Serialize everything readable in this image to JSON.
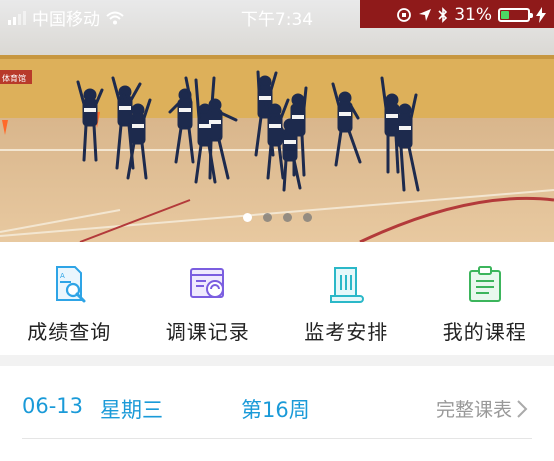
{
  "status_bar": {
    "carrier": "中国移动",
    "time": "下午7:34",
    "battery_percent": "31%",
    "battery_level": 0.31,
    "battery_color": "#4cd964"
  },
  "banner": {
    "sign_text": "体育馆",
    "slide_count": 4,
    "active_slide": 1
  },
  "menu": {
    "items": [
      {
        "label": "成绩查询",
        "icon": "grade-search-icon",
        "color": "#2ea4e6"
      },
      {
        "label": "调课记录",
        "icon": "schedule-change-icon",
        "color": "#7b5ee0"
      },
      {
        "label": "监考安排",
        "icon": "scroll-icon",
        "color": "#2bb8c8"
      },
      {
        "label": "我的课程",
        "icon": "clipboard-icon",
        "color": "#3cb55c"
      }
    ]
  },
  "schedule": {
    "date": "06-13",
    "weekday": "星期三",
    "week": "第16周",
    "full_label": "完整课表",
    "accent": "#1a9ad8"
  }
}
